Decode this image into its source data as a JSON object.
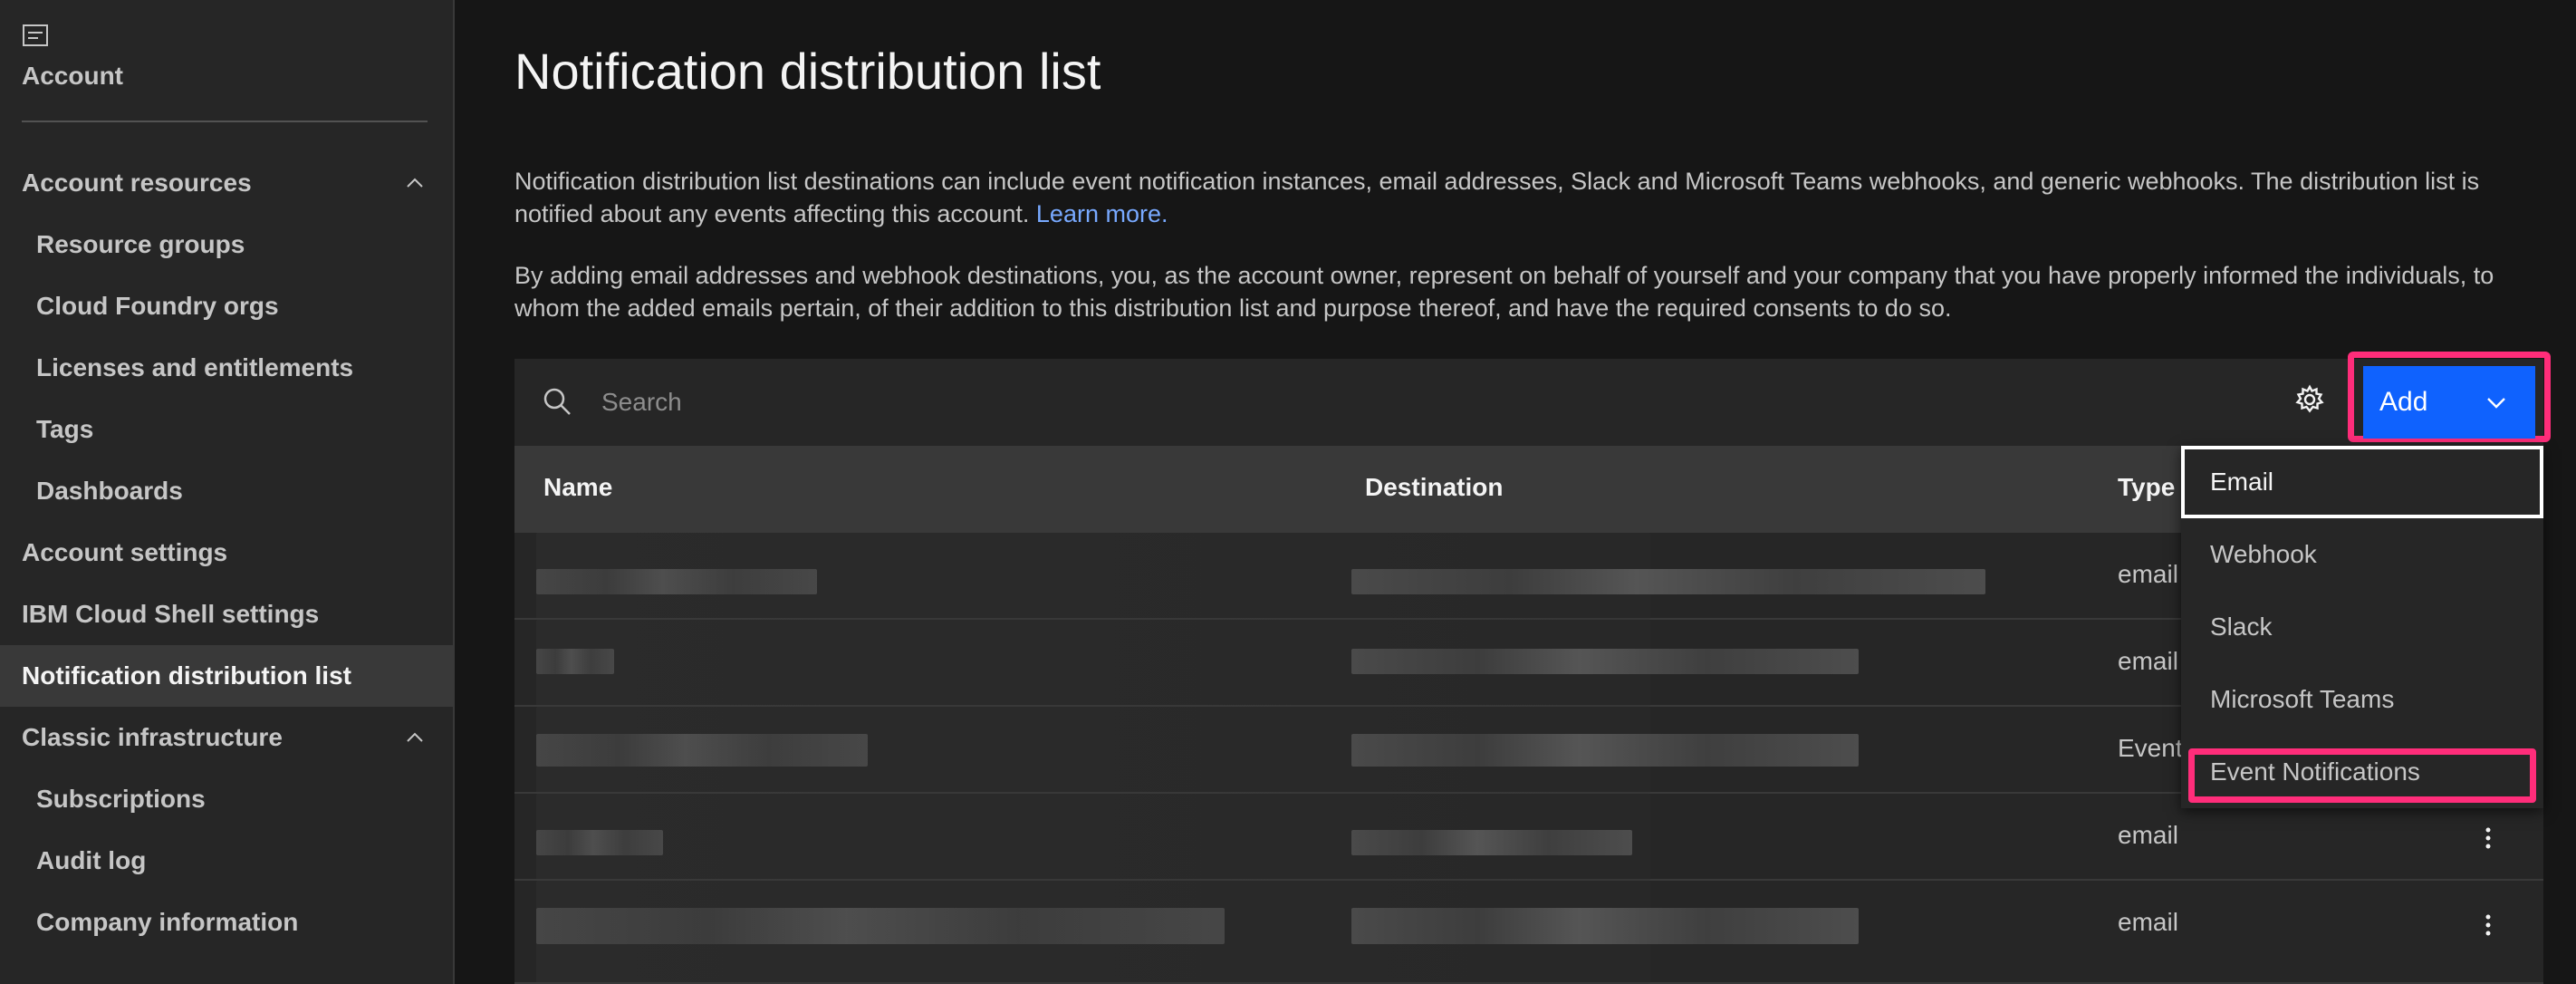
{
  "sidebar": {
    "icon": "panel-icon",
    "title": "Account",
    "items": [
      {
        "label": "Account resources",
        "expanded": true
      },
      {
        "label": "Resource groups"
      },
      {
        "label": "Cloud Foundry orgs"
      },
      {
        "label": "Licenses and entitlements"
      },
      {
        "label": "Tags"
      },
      {
        "label": "Dashboards"
      },
      {
        "label": "Account settings"
      },
      {
        "label": "IBM Cloud Shell settings"
      },
      {
        "label": "Notification distribution list",
        "active": true
      },
      {
        "label": "Classic infrastructure",
        "expanded": true
      },
      {
        "label": "Subscriptions"
      },
      {
        "label": "Audit log"
      },
      {
        "label": "Company information"
      }
    ]
  },
  "page": {
    "title": "Notification distribution list",
    "description_1": "Notification distribution list destinations can include event notification instances, email addresses, Slack and Microsoft Teams webhooks, and generic webhooks. The distribution list is notified about any events affecting this account.",
    "learn_more": "Learn more.",
    "description_2": "By adding email addresses and webhook destinations, you, as the account owner, represent on behalf of yourself and your company that you have properly informed the individuals, to whom the added emails pertain, of their addition to this distribution list and purpose thereof, and have the required consents to do so."
  },
  "toolbar": {
    "search_placeholder": "Search",
    "add_label": "Add"
  },
  "table": {
    "columns": [
      "Name",
      "Destination",
      "Type"
    ],
    "rows": [
      {
        "type": "email"
      },
      {
        "type": "email"
      },
      {
        "type": "Event Notifications"
      },
      {
        "type": "email"
      },
      {
        "type": "email"
      }
    ]
  },
  "add_menu": {
    "items": [
      "Email",
      "Webhook",
      "Slack",
      "Microsoft Teams",
      "Event Notifications"
    ],
    "focused": "Email",
    "highlighted": "Event Notifications"
  },
  "colors": {
    "accent": "#0f62fe",
    "highlight": "#ff2d7a",
    "link": "#78a9ff"
  }
}
